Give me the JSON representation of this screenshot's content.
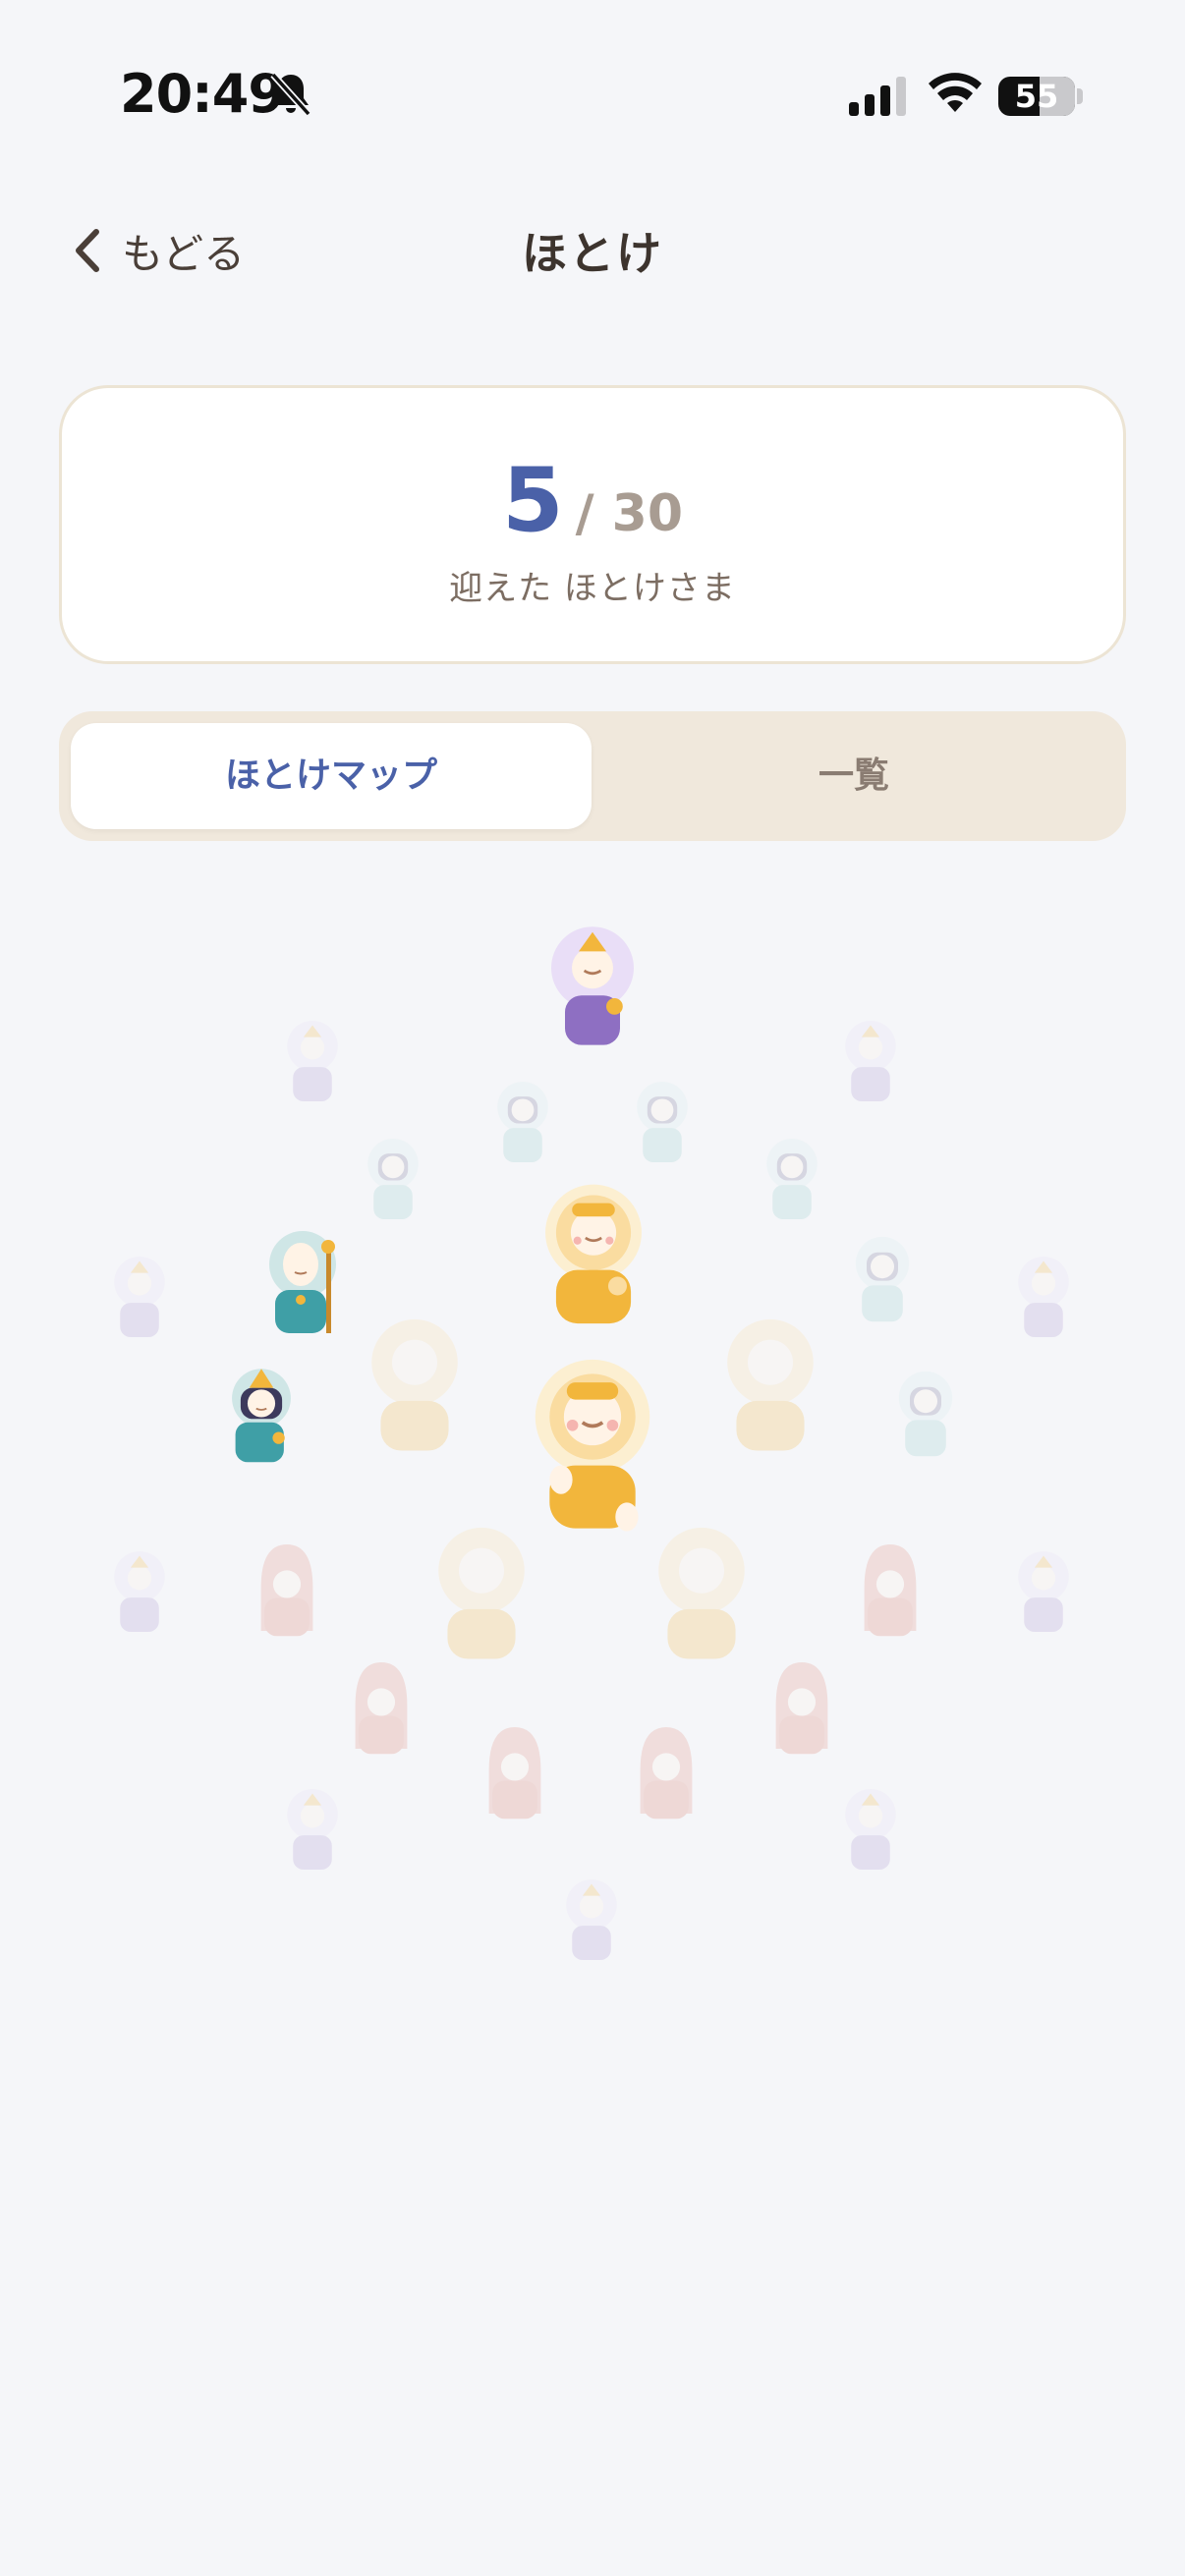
{
  "status_bar": {
    "time": "20:49",
    "battery": "55",
    "icons": [
      "bell-slash-icon",
      "signal-icon",
      "wifi-icon",
      "battery-icon"
    ]
  },
  "nav": {
    "back_label": "もどる",
    "back_icon": "chevron-left-icon",
    "title": "ほとけ"
  },
  "counter": {
    "collected": "5",
    "total": "/ 30",
    "caption": "迎えた ほとけさま"
  },
  "tabs": [
    {
      "label": "ほとけマップ",
      "active": true
    },
    {
      "label": "一覧",
      "active": false
    }
  ],
  "colors": {
    "accent": "#4a61a8",
    "gold": "#f2b63c",
    "teal": "#3f9fa6",
    "purple": "#8e6fc2",
    "red": "#e08a7a"
  },
  "map": {
    "collected_count": 5,
    "total_count": 30
  }
}
